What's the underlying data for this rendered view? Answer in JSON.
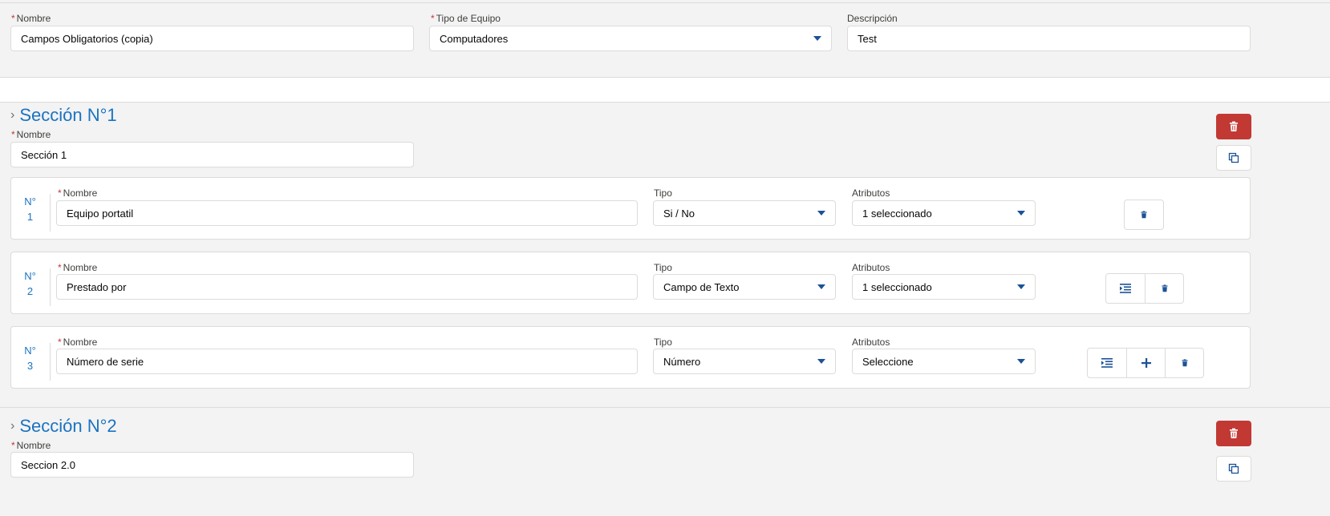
{
  "header": {
    "nombre": {
      "label": "Nombre",
      "value": "Campos Obligatorios (copia)"
    },
    "tipo_equipo": {
      "label": "Tipo de Equipo",
      "value": "Computadores"
    },
    "descripcion": {
      "label": "Descripción",
      "value": "Test"
    }
  },
  "sections": [
    {
      "title": "Sección N°1",
      "name_label": "Nombre",
      "name_value": "Sección 1",
      "fields": [
        {
          "num_label": "N°",
          "num": "1",
          "name_label": "Nombre",
          "name_value": "Equipo portatil",
          "tipo_label": "Tipo",
          "tipo_value": "Si / No",
          "attr_label": "Atributos",
          "attr_value": "1 seleccionado"
        },
        {
          "num_label": "N°",
          "num": "2",
          "name_label": "Nombre",
          "name_value": "Prestado por",
          "tipo_label": "Tipo",
          "tipo_value": "Campo de Texto",
          "attr_label": "Atributos",
          "attr_value": "1 seleccionado"
        },
        {
          "num_label": "N°",
          "num": "3",
          "name_label": "Nombre",
          "name_value": "Número de serie",
          "tipo_label": "Tipo",
          "tipo_value": "Número",
          "attr_label": "Atributos",
          "attr_value": "Seleccione"
        }
      ]
    },
    {
      "title": "Sección N°2",
      "name_label": "Nombre",
      "name_value": "Seccion 2.0"
    }
  ],
  "icons": {
    "delete": "trash-icon",
    "copy": "copy-icon",
    "indent": "indent-icon",
    "add": "plus-icon",
    "expand": "chevron-right-icon"
  },
  "colors": {
    "accent": "#1b73c1",
    "danger": "#c23934",
    "icon_blue": "#1b5297"
  }
}
